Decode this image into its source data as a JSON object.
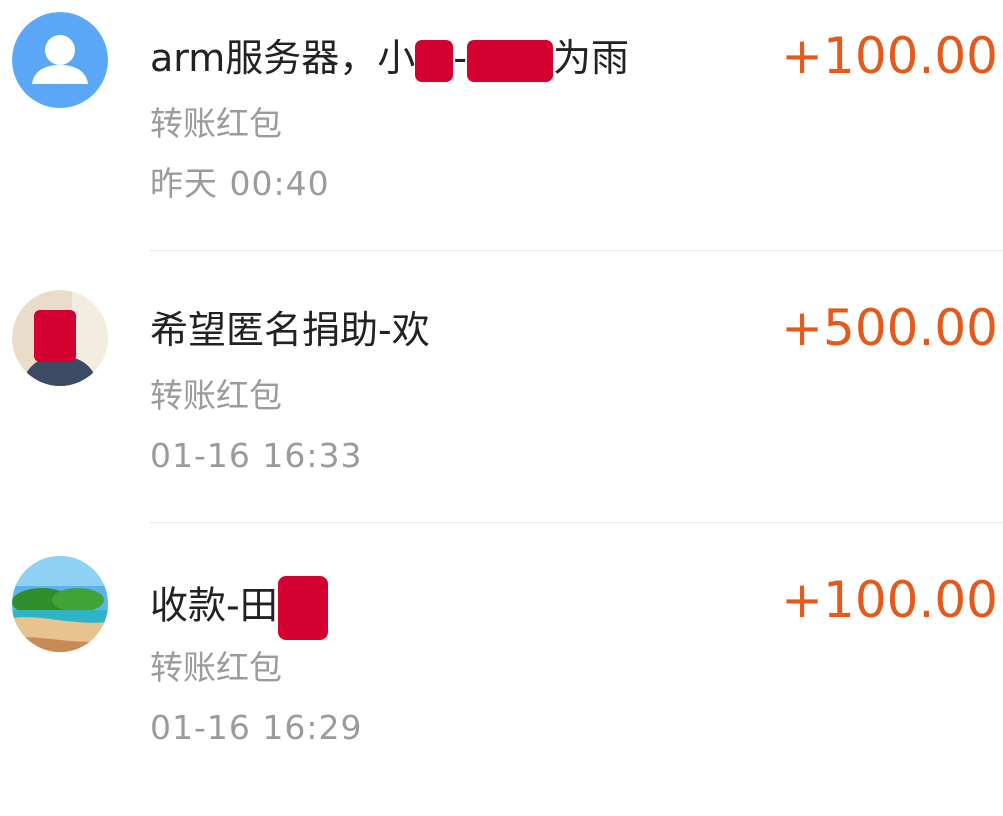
{
  "transactions": [
    {
      "title": "arm服务器，小",
      "title_mid": "-",
      "title_end": "为雨",
      "subtitle": "转账红包",
      "time": "昨天  00:40",
      "amount": "+100.00",
      "avatar_icon": "default-user-icon"
    },
    {
      "title": "希望匿名捐助-欢",
      "subtitle": "转账红包",
      "time": "01-16  16:33",
      "amount": "+500.00",
      "avatar_icon": "user-photo"
    },
    {
      "title": "收款-田",
      "subtitle": "转账红包",
      "time": "01-16  16:29",
      "amount": "+100.00",
      "avatar_icon": "beach-photo"
    }
  ],
  "colors": {
    "amount": "#e35a1b",
    "title": "#222222",
    "secondary": "#9b9b9b",
    "redaction": "#d4002f",
    "default_avatar": "#5aa8f5"
  }
}
